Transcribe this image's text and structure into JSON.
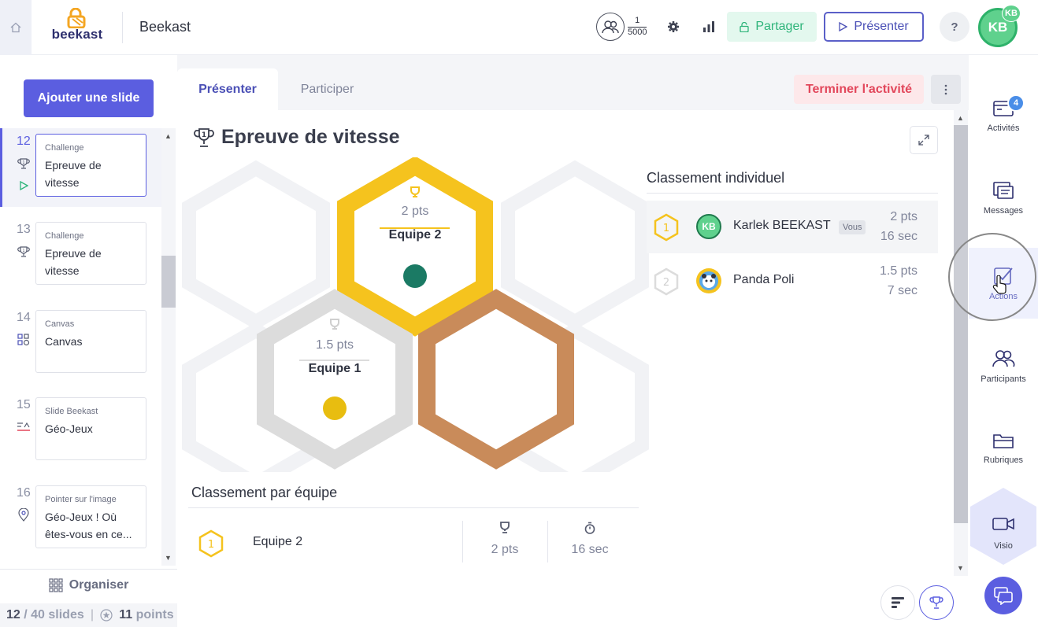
{
  "header": {
    "logo_text": "beekast",
    "app_title": "Beekast",
    "participants_count": "1",
    "participants_max": "5000",
    "share_label": "Partager",
    "present_label": "Présenter",
    "help_label": "?",
    "avatar_initials": "KB",
    "avatar_small_initials": "KB"
  },
  "sidebar": {
    "add_slide_label": "Ajouter une slide",
    "slides": [
      {
        "num": "12",
        "type": "Challenge",
        "name": "Epreuve de vitesse",
        "icon": "trophy-icon",
        "active": true
      },
      {
        "num": "13",
        "type": "Challenge",
        "name": "Epreuve de vitesse",
        "icon": "trophy-icon"
      },
      {
        "num": "14",
        "type": "Canvas",
        "name": "Canvas",
        "icon": "canvas-icon"
      },
      {
        "num": "15",
        "type": "Slide Beekast",
        "name": "Géo-Jeux",
        "icon": "slide-icon"
      },
      {
        "num": "16",
        "type": "Pointer sur l'image",
        "name": "Géo-Jeux ! Où êtes-vous en ce...",
        "icon": "pin-icon"
      }
    ],
    "organize_label": "Organiser",
    "current_slide": "12",
    "total_slides": "/ 40 slides",
    "points_value": "11",
    "points_label": "points"
  },
  "main": {
    "tabs": [
      {
        "label": "Présenter",
        "active": true
      },
      {
        "label": "Participer",
        "active": false
      }
    ],
    "end_activity_label": "Terminer l'activité",
    "activity_title": "Epreuve de vitesse",
    "podium": [
      {
        "rank": 1,
        "pts": "2 pts",
        "team": "Equipe 2",
        "color": "#f5c31e",
        "dot": "#1b7a64"
      },
      {
        "rank": 2,
        "pts": "1.5 pts",
        "team": "Equipe 1",
        "color": "#dcdcdc",
        "dot": "#e8bd10"
      },
      {
        "rank": 3,
        "pts": "",
        "team": "",
        "color": "#c98b5a",
        "dot": ""
      }
    ],
    "individual_ranking_title": "Classement individuel",
    "individual_ranking": [
      {
        "rank": "1",
        "initials": "KB",
        "name": "Karlek BEEKAST",
        "you_badge": "Vous",
        "pts": "2 pts",
        "time": "16 sec"
      },
      {
        "rank": "2",
        "initials": "",
        "name": "Panda Poli",
        "you_badge": "",
        "pts": "1.5 pts",
        "time": "7 sec"
      }
    ],
    "team_ranking_title": "Classement par équipe",
    "team_ranking": [
      {
        "rank": "1",
        "team": "Equipe 2",
        "pts": "2 pts",
        "time": "16 sec"
      }
    ]
  },
  "rightbar": {
    "items": [
      {
        "label": "Activités",
        "icon": "activities-icon",
        "badge": "4"
      },
      {
        "label": "Messages",
        "icon": "messages-icon"
      },
      {
        "label": "Actions",
        "icon": "actions-icon",
        "selected": true
      },
      {
        "label": "Participants",
        "icon": "participants-icon"
      },
      {
        "label": "Rubriques",
        "icon": "folder-icon"
      },
      {
        "label": "Visio",
        "icon": "video-icon"
      }
    ]
  },
  "colors": {
    "primary": "#5b5ee0",
    "gold": "#f5c31e",
    "silver": "#dcdcdc",
    "bronze": "#c98b5a",
    "danger": "#e2475b",
    "success": "#2eb47a"
  }
}
